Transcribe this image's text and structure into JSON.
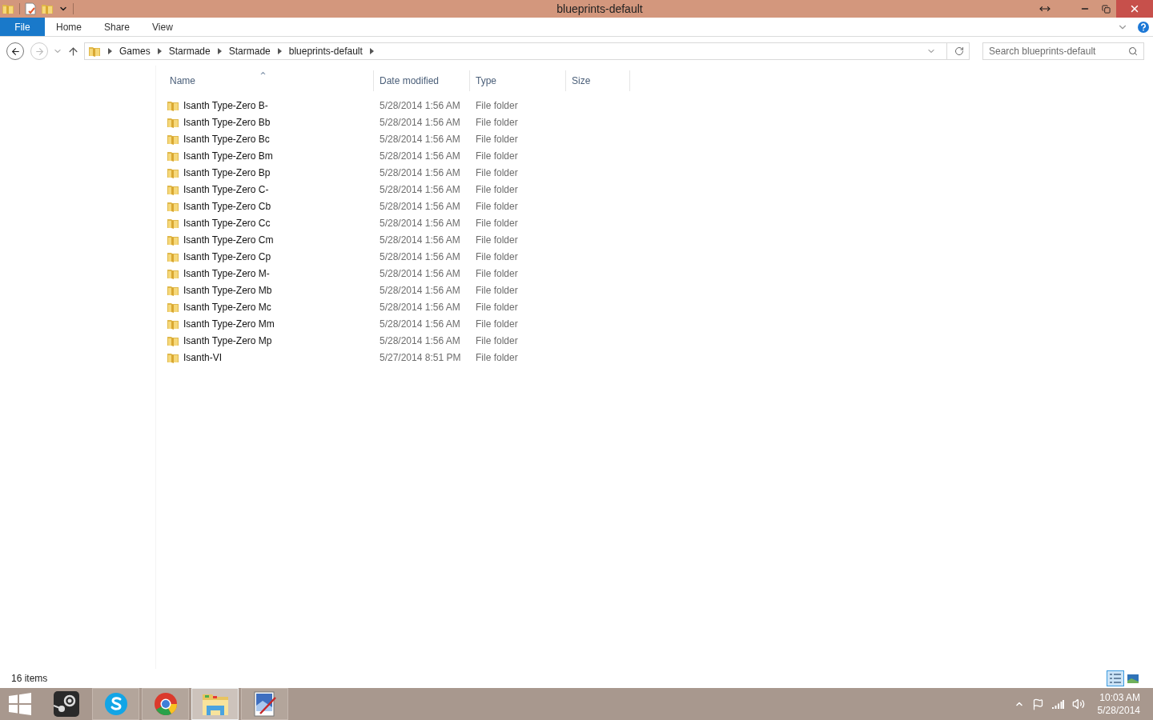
{
  "window": {
    "title": "blueprints-default"
  },
  "ribbon_tabs": [
    {
      "label": "File",
      "kind": "file"
    },
    {
      "label": "Home",
      "kind": "tab"
    },
    {
      "label": "Share",
      "kind": "tab"
    },
    {
      "label": "View",
      "kind": "tab"
    }
  ],
  "breadcrumb": [
    "Games",
    "Starmade",
    "Starmade",
    "blueprints-default"
  ],
  "search": {
    "placeholder": "Search blueprints-default"
  },
  "columns": [
    "Name",
    "Date modified",
    "Type",
    "Size"
  ],
  "rows": [
    {
      "name": "Isanth Type-Zero B-",
      "date": "5/28/2014 1:56 AM",
      "type": "File folder"
    },
    {
      "name": "Isanth Type-Zero Bb",
      "date": "5/28/2014 1:56 AM",
      "type": "File folder"
    },
    {
      "name": "Isanth Type-Zero Bc",
      "date": "5/28/2014 1:56 AM",
      "type": "File folder"
    },
    {
      "name": "Isanth Type-Zero Bm",
      "date": "5/28/2014 1:56 AM",
      "type": "File folder"
    },
    {
      "name": "Isanth Type-Zero Bp",
      "date": "5/28/2014 1:56 AM",
      "type": "File folder"
    },
    {
      "name": "Isanth Type-Zero C-",
      "date": "5/28/2014 1:56 AM",
      "type": "File folder"
    },
    {
      "name": "Isanth Type-Zero Cb",
      "date": "5/28/2014 1:56 AM",
      "type": "File folder"
    },
    {
      "name": "Isanth Type-Zero Cc",
      "date": "5/28/2014 1:56 AM",
      "type": "File folder"
    },
    {
      "name": "Isanth Type-Zero Cm",
      "date": "5/28/2014 1:56 AM",
      "type": "File folder"
    },
    {
      "name": "Isanth Type-Zero Cp",
      "date": "5/28/2014 1:56 AM",
      "type": "File folder"
    },
    {
      "name": "Isanth Type-Zero M-",
      "date": "5/28/2014 1:56 AM",
      "type": "File folder"
    },
    {
      "name": "Isanth Type-Zero Mb",
      "date": "5/28/2014 1:56 AM",
      "type": "File folder"
    },
    {
      "name": "Isanth Type-Zero Mc",
      "date": "5/28/2014 1:56 AM",
      "type": "File folder"
    },
    {
      "name": "Isanth Type-Zero Mm",
      "date": "5/28/2014 1:56 AM",
      "type": "File folder"
    },
    {
      "name": "Isanth Type-Zero Mp",
      "date": "5/28/2014 1:56 AM",
      "type": "File folder"
    },
    {
      "name": "Isanth-VI",
      "date": "5/27/2014 8:51 PM",
      "type": "File folder"
    }
  ],
  "status_bar": {
    "count": "16 items",
    "views": [
      {
        "kind": "details",
        "selected": true
      },
      {
        "kind": "tiles",
        "selected": false
      }
    ]
  },
  "taskbar": {
    "apps": [
      {
        "kind": "steam",
        "selected": false
      },
      {
        "kind": "skype",
        "selected": false
      },
      {
        "kind": "chrome",
        "selected": false
      },
      {
        "kind": "explorer",
        "selected": true
      },
      {
        "kind": "paint",
        "selected": false
      }
    ],
    "time": "10:03 AM",
    "date": "5/28/2014"
  }
}
